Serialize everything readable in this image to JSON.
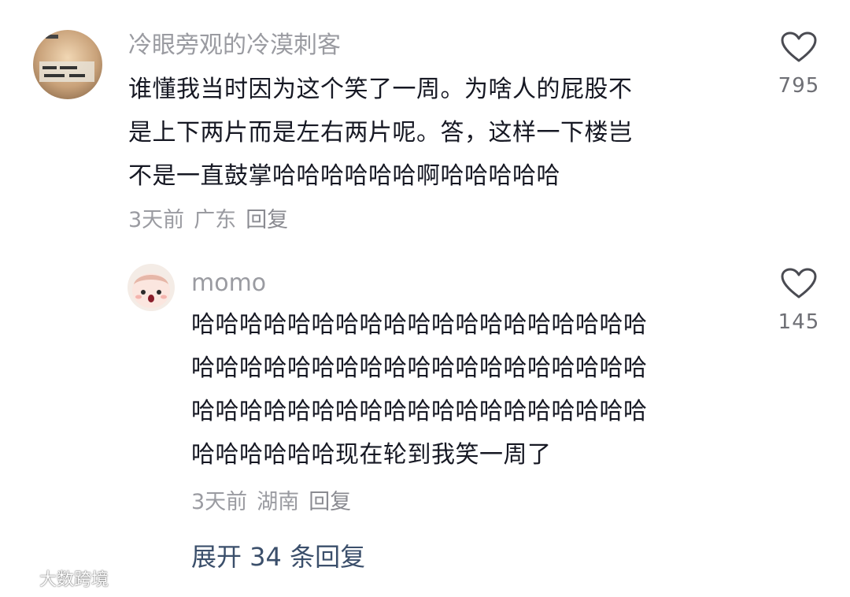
{
  "comments": [
    {
      "username": "冷眼旁观的冷漠刺客",
      "text_lines": [
        "谁懂我当时因为这个笑了一周。为啥人的屁股不",
        "是上下两片而是左右两片呢。答，这样一下楼岂",
        "不是一直鼓掌哈哈哈哈哈哈啊哈哈哈哈哈"
      ],
      "time": "3天前",
      "location": "广东",
      "reply_label": "回复",
      "likes": "795",
      "avatar_icon": "meme-avatar-icon"
    },
    {
      "username": "momo",
      "text_lines": [
        "哈哈哈哈哈哈哈哈哈哈哈哈哈哈哈哈哈哈哈",
        "哈哈哈哈哈哈哈哈哈哈哈哈哈哈哈哈哈哈哈",
        "哈哈哈哈哈哈哈哈哈哈哈哈哈哈哈哈哈哈哈",
        "哈哈哈哈哈哈现在轮到我笑一周了"
      ],
      "time": "3天前",
      "location": "湖南",
      "reply_label": "回复",
      "likes": "145",
      "avatar_icon": "cartoon-face-avatar-icon"
    }
  ],
  "expand_replies": "展开 34 条回复",
  "watermark": "大数跨境",
  "colors": {
    "text": "#161823",
    "secondary": "#9a9ba1",
    "link": "#3b4f6b",
    "background": "#ffffff"
  }
}
